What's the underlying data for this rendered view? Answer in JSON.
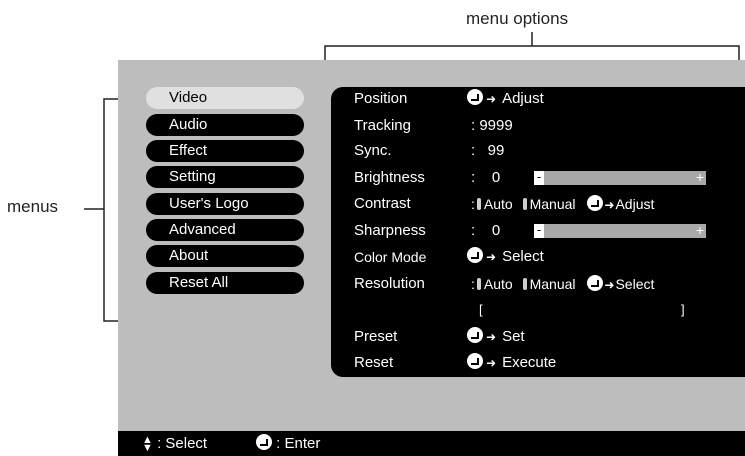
{
  "callouts": {
    "menu_options": "menu options",
    "menus": "menus"
  },
  "menus": [
    {
      "label": "Video",
      "active": true
    },
    {
      "label": "Audio"
    },
    {
      "label": "Effect"
    },
    {
      "label": "Setting"
    },
    {
      "label": "User's Logo"
    },
    {
      "label": "Advanced"
    },
    {
      "label": "About"
    },
    {
      "label": "Reset All"
    }
  ],
  "options": {
    "position": {
      "label": "Position",
      "action": "Adjust"
    },
    "tracking": {
      "label": "Tracking",
      "value": ": 9999"
    },
    "sync": {
      "label": "Sync.",
      "value": ":   99"
    },
    "brightness": {
      "label": "Brightness",
      "value": ":    0",
      "minus": "-",
      "plus": "+"
    },
    "contrast": {
      "label": "Contrast",
      "prefix": ":",
      "auto": "Auto",
      "manual": "Manual",
      "action": "Adjust"
    },
    "sharpness": {
      "label": "Sharpness",
      "value": ":    0",
      "minus": "-",
      "plus": "+"
    },
    "color_mode": {
      "label": "Color Mode",
      "action": "Select"
    },
    "resolution": {
      "label": "Resolution",
      "prefix": ":",
      "auto": "Auto",
      "manual": "Manual",
      "action": "Select"
    },
    "resolution_field": {
      "open": "[",
      "close": "]"
    },
    "preset": {
      "label": "Preset",
      "action": "Set"
    },
    "reset": {
      "label": "Reset",
      "action": "Execute"
    }
  },
  "footer": {
    "select": ": Select",
    "enter": ": Enter"
  }
}
